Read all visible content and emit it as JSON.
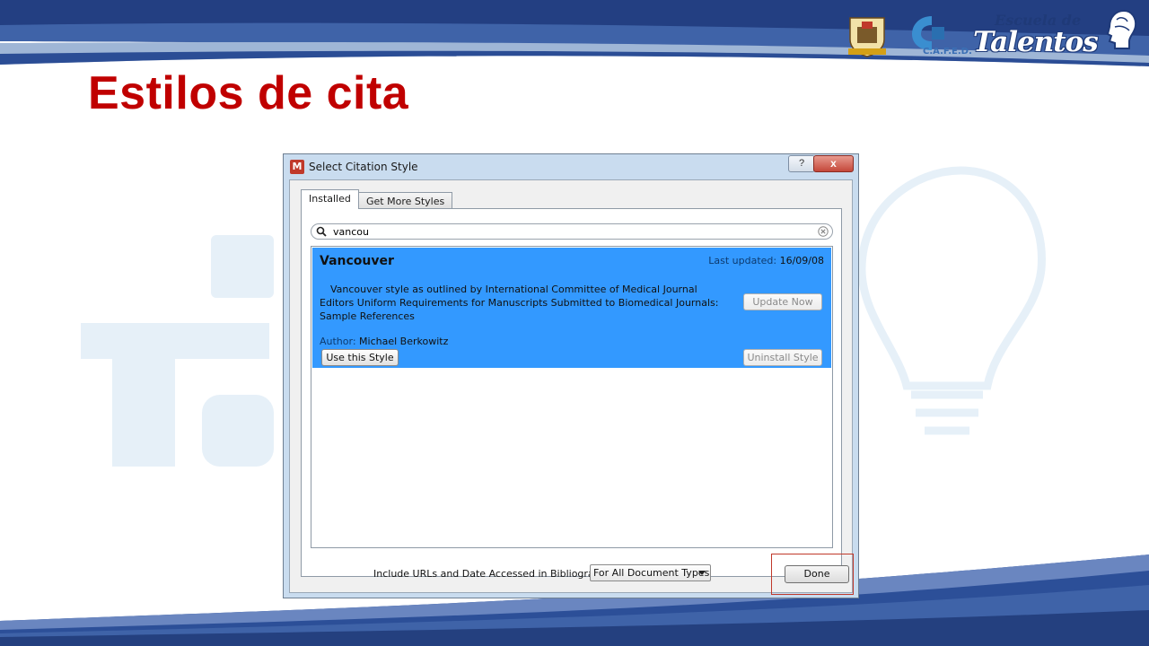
{
  "slide": {
    "title": "Estilos de cita",
    "logos": {
      "escuela": "Escuela de",
      "talentos": "Talentos",
      "cafed": "C.A.F.E.D."
    }
  },
  "dialog": {
    "title": "Select Citation Style",
    "help_label": "?",
    "close_label": "x",
    "tabs": [
      {
        "label": "Installed",
        "selected": true
      },
      {
        "label": "Get More Styles",
        "selected": false
      }
    ],
    "search": {
      "value": "vancou",
      "icon": "search-icon"
    },
    "results": [
      {
        "name": "Vancouver",
        "last_updated_label": "Last updated:",
        "last_updated_value": "16/09/08",
        "description": "Vancouver style as outlined by International Committee of Medical Journal Editors Uniform Requirements for Manuscripts Submitted to Biomedical Journals: Sample References",
        "author_label": "Author:",
        "author_value": "Michael Berkowitz",
        "use_button": "Use this Style",
        "update_button": "Update Now",
        "uninstall_button": "Uninstall Style"
      }
    ],
    "footer": {
      "include_label": "Include URLs and Date Accessed in Bibliographies:",
      "select_value": "For All Document Types",
      "done_button": "Done"
    }
  },
  "colors": {
    "title_red": "#c00000",
    "selection_blue": "#3399ff",
    "band_navy": "#1f3a78",
    "highlight_red": "#c0392b"
  }
}
